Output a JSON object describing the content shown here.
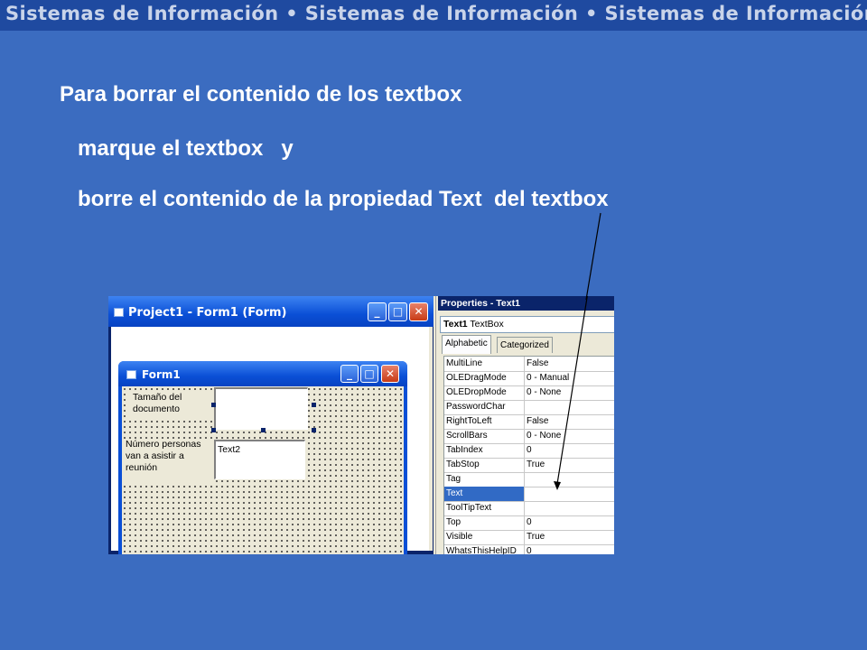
{
  "banner": {
    "text": "Sistemas de Información • Sistemas de Información • Sistemas de Información"
  },
  "instructions": {
    "line1": "Para borrar el contenido de los textbox",
    "line2": "marque el textbox   y",
    "line3": "borre el contenido de la propiedad Text  del textbox"
  },
  "project_window": {
    "title": "Project1 - Form1 (Form)",
    "form": {
      "title": "Form1",
      "label1": "Tamaño del documento",
      "label2": "Número personas van a asistir a reunión",
      "textbox1_value": "",
      "textbox2_value": "Text2"
    }
  },
  "properties_window": {
    "title": "Properties - Text1",
    "object_name": "Text1",
    "object_type": "TextBox",
    "tabs": [
      "Alphabetic",
      "Categorized"
    ],
    "selected_tab": "Alphabetic",
    "selected_property": "Text",
    "rows": [
      {
        "name": "MultiLine",
        "value": "False"
      },
      {
        "name": "OLEDragMode",
        "value": "0 - Manual"
      },
      {
        "name": "OLEDropMode",
        "value": "0 - None"
      },
      {
        "name": "PasswordChar",
        "value": ""
      },
      {
        "name": "RightToLeft",
        "value": "False"
      },
      {
        "name": "ScrollBars",
        "value": "0 - None"
      },
      {
        "name": "TabIndex",
        "value": "0"
      },
      {
        "name": "TabStop",
        "value": "True"
      },
      {
        "name": "Tag",
        "value": ""
      },
      {
        "name": "Text",
        "value": ""
      },
      {
        "name": "ToolTipText",
        "value": ""
      },
      {
        "name": "Top",
        "value": "0"
      },
      {
        "name": "Visible",
        "value": "True"
      },
      {
        "name": "WhatsThisHelpID",
        "value": "0"
      }
    ]
  },
  "colors": {
    "background": "#3b6cc0",
    "banner": "#1f4aa0",
    "selection": "#316ac5"
  }
}
